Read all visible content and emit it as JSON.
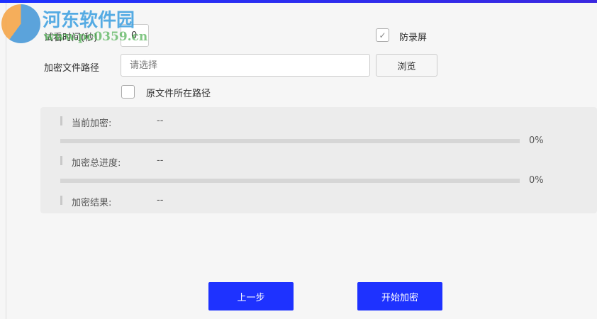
{
  "watermark": {
    "name": "河东软件园",
    "url": "www.pc0359.cn"
  },
  "form": {
    "trial_time_label": "试看时间(秒)",
    "trial_time_value": "0",
    "anti_record_label": "防录屏",
    "anti_record_checked": true,
    "path_label": "加密文件路径",
    "path_placeholder": "请选择",
    "browse_label": "浏览",
    "original_path_label": "原文件所在路径",
    "original_path_checked": false
  },
  "progress": {
    "current_label": "当前加密:",
    "current_value": "--",
    "current_percent": "0%",
    "total_label": "加密总进度:",
    "total_value": "--",
    "total_percent": "0%",
    "result_label": "加密结果:",
    "result_value": "--"
  },
  "buttons": {
    "prev": "上一步",
    "start": "开始加密"
  }
}
